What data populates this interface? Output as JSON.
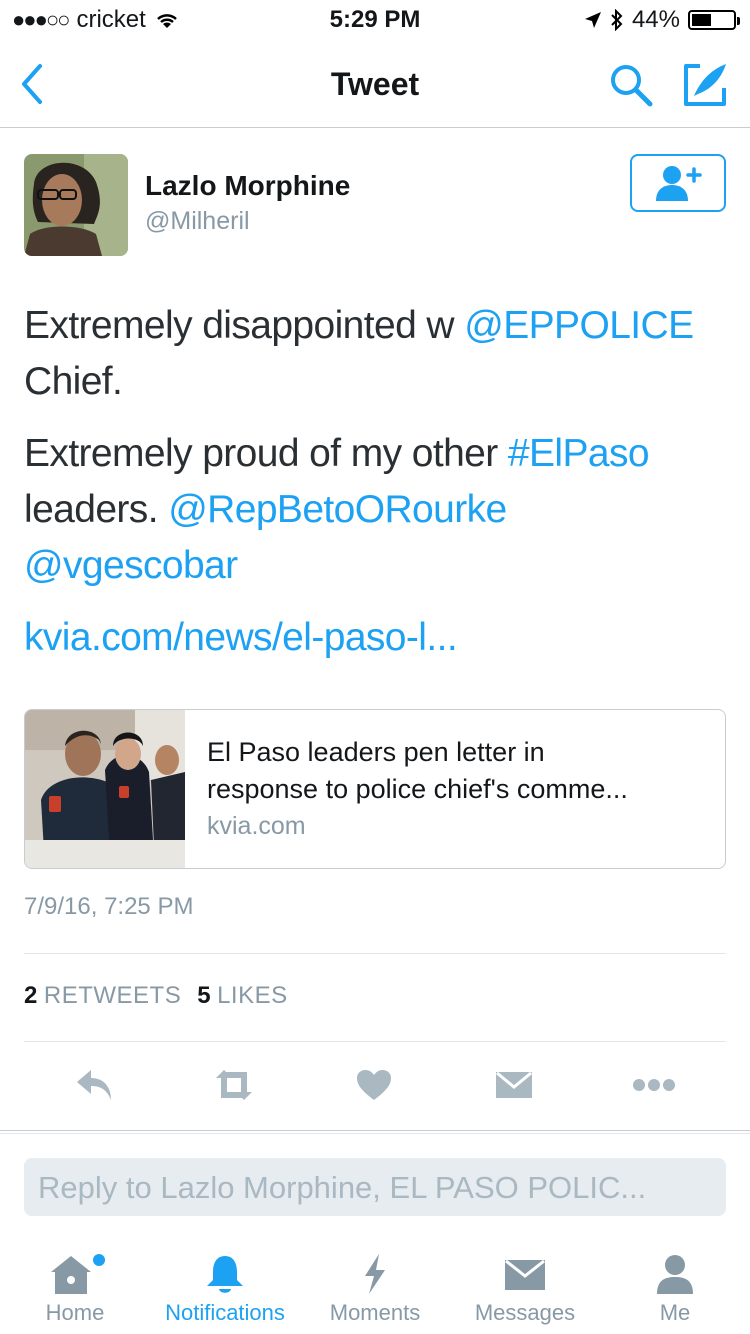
{
  "status_bar": {
    "carrier": "cricket",
    "time": "5:29 PM",
    "battery": "44%",
    "battery_level": 0.44,
    "icons": [
      "signal-dots-icon",
      "wifi-icon",
      "location-arrow-icon",
      "bluetooth-icon",
      "battery-icon"
    ]
  },
  "nav": {
    "title": "Tweet",
    "back_icon": "chevron-left-icon",
    "search_icon": "search-icon",
    "compose_icon": "compose-icon"
  },
  "author": {
    "name": "Lazlo Morphine",
    "handle": "@Milheril",
    "follow_icon": "add-user-icon"
  },
  "tweet": {
    "p1": {
      "t1": "Extremely disappointed w ",
      "mention": "@EPPOLICE",
      "t2": " Chief."
    },
    "p2": {
      "t1": "Extremely proud of my other ",
      "hashtag": "#ElPaso",
      "t2": " leaders. ",
      "mention1": "@RepBetoORourke",
      "mention2": "@vgescobar"
    },
    "link": "kvia.com/news/el-paso-l..."
  },
  "card": {
    "title": "El Paso leaders pen letter in\nresponse to police chief's comme...",
    "domain": "kvia.com"
  },
  "timestamp": "7/9/16, 7:25 PM",
  "stats": {
    "retweets_count": "2",
    "retweets_label": "RETWEETS",
    "likes_count": "5",
    "likes_label": "LIKES"
  },
  "actions": [
    "reply-icon",
    "retweet-icon",
    "like-icon",
    "direct-message-icon",
    "more-icon"
  ],
  "reply": {
    "placeholder": "Reply to Lazlo Morphine, EL PASO POLIC..."
  },
  "tabs": [
    {
      "label": "Home",
      "icon": "home-icon"
    },
    {
      "label": "Notifications",
      "icon": "bell-icon"
    },
    {
      "label": "Moments",
      "icon": "lightning-icon"
    },
    {
      "label": "Messages",
      "icon": "envelope-icon"
    },
    {
      "label": "Me",
      "icon": "person-icon"
    }
  ],
  "colors": {
    "accent": "#1da1f2",
    "secondary_text": "#8899a6",
    "action_icon": "#aab8c2"
  }
}
